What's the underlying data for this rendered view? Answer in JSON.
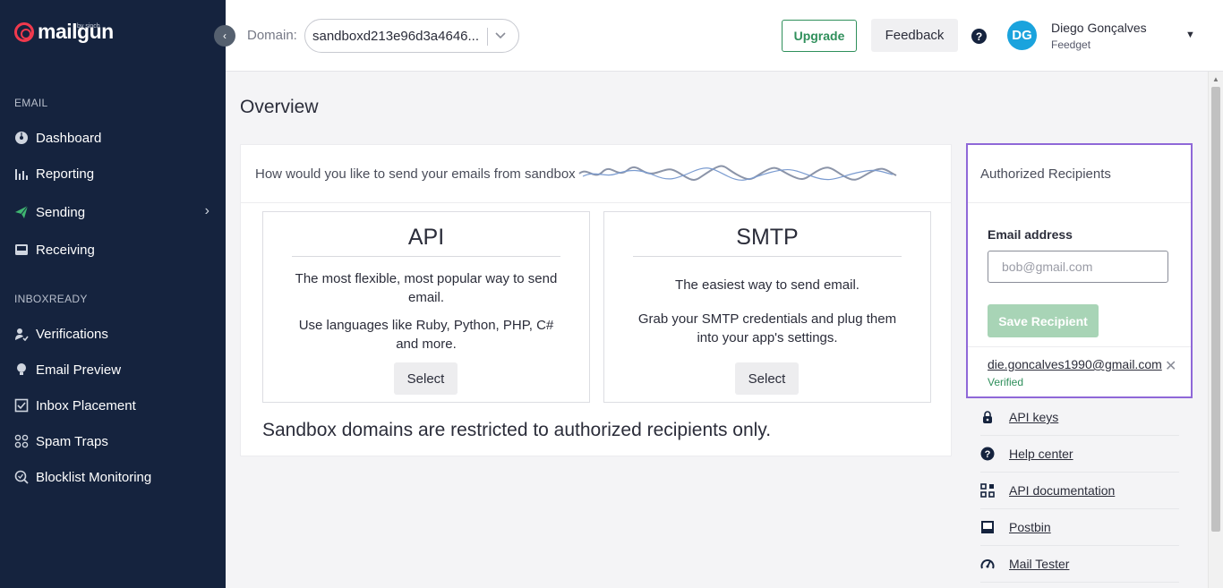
{
  "brand": {
    "name": "mailgun",
    "sub": "by sinch"
  },
  "sidebar": {
    "sections": [
      {
        "label": "EMAIL",
        "items": [
          {
            "label": "Dashboard",
            "icon": "dashboard-icon"
          },
          {
            "label": "Reporting",
            "icon": "bar-chart-icon"
          },
          {
            "label": "Sending",
            "icon": "paper-plane-icon",
            "has_submenu": true
          },
          {
            "label": "Receiving",
            "icon": "inbox-icon"
          }
        ]
      },
      {
        "label": "INBOXREADY",
        "items": [
          {
            "label": "Verifications",
            "icon": "verification-icon"
          },
          {
            "label": "Email Preview",
            "icon": "lightbulb-icon"
          },
          {
            "label": "Inbox Placement",
            "icon": "checkbox-icon"
          },
          {
            "label": "Spam Traps",
            "icon": "spam-trap-icon"
          },
          {
            "label": "Blocklist Monitoring",
            "icon": "search-check-icon"
          }
        ]
      }
    ]
  },
  "topbar": {
    "domain_label": "Domain:",
    "domain_value": "sandboxd213e96d3a4646...",
    "upgrade_label": "Upgrade",
    "feedback_label": "Feedback",
    "user": {
      "initials": "DG",
      "name": "Diego Gonçalves",
      "org": "Feedget"
    }
  },
  "main": {
    "title": "Overview",
    "send_question": "How would you like to send your emails from sandbox",
    "options": [
      {
        "title": "API",
        "desc1": "The most flexible, most popular way to send email.",
        "desc2": "Use languages like Ruby, Python, PHP, C# and more.",
        "button": "Select"
      },
      {
        "title": "SMTP",
        "desc1": "The easiest way to send email.",
        "desc2": "Grab your SMTP credentials and plug them into your app's settings.",
        "button": "Select"
      }
    ],
    "sandbox_note": "Sandbox domains are restricted to authorized recipients only."
  },
  "recipients": {
    "title": "Authorized Recipients",
    "email_label": "Email address",
    "email_placeholder": "bob@gmail.com",
    "save_label": "Save Recipient",
    "list": [
      {
        "email": "die.goncalves1990@gmail.com",
        "status": "Verified"
      }
    ]
  },
  "links": [
    {
      "label": "API keys",
      "icon": "lock-icon"
    },
    {
      "label": "Help center",
      "icon": "help-icon"
    },
    {
      "label": "API documentation",
      "icon": "grid-icon"
    },
    {
      "label": "Postbin",
      "icon": "inbox-tray-icon"
    },
    {
      "label": "Mail Tester",
      "icon": "gauge-icon"
    }
  ],
  "colors": {
    "sidebar": "#15233e",
    "accent_green": "#2f8f5b",
    "focus_purple": "#8f68d8",
    "avatar": "#1aa3dd",
    "logo_red": "#f0394d"
  }
}
